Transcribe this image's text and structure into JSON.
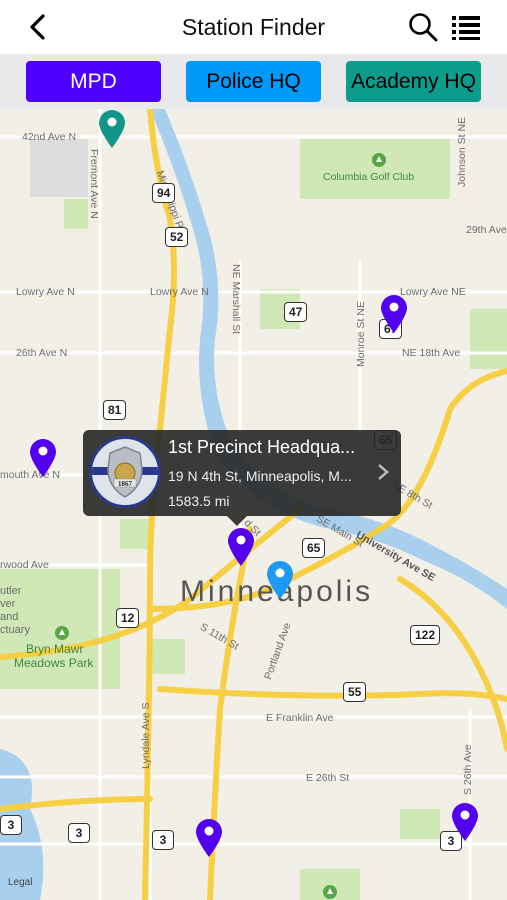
{
  "header": {
    "title": "Station Finder"
  },
  "filters": [
    {
      "label": "MPD",
      "color": "#4d00ff"
    },
    {
      "label": "Police HQ",
      "color": "#0099f8"
    },
    {
      "label": "Academy HQ",
      "color": "#0c9c8c"
    }
  ],
  "map": {
    "city": "Minneapolis",
    "legal": "Legal",
    "street_labels": [
      "42nd Ave N",
      "Fremont Ave N",
      "Mississippi River",
      "Columbia Golf Club",
      "Johnson St NE",
      "29th Ave",
      "Lowry Ave N",
      "Lowry Ave N",
      "NE Marshall St",
      "Lowry Ave NE",
      "26th Ave N",
      "NE 18th Ave",
      "Monroe St NE",
      "mouth Ave N",
      "SE 8th St",
      "SE Main St",
      "University Ave SE",
      "rwood Ave",
      "utler",
      "ver",
      "and",
      "ctuary",
      "Bryn Mawr",
      "Meadows Park",
      "S 11th St",
      "Portland Ave",
      "E Franklin Ave",
      "E 26th St",
      "Lyndale Ave S",
      "S 26th Ave",
      "d St"
    ],
    "shields": [
      "94",
      "52",
      "47",
      "81",
      "65",
      "65",
      "12",
      "122",
      "55",
      "3",
      "3",
      "3",
      "3",
      "67"
    ]
  },
  "callout": {
    "name": "1st Precinct Headqua...",
    "address": "19 N 4th St, Minneapolis, M...",
    "distance": "1583.5 mi",
    "badge_year": "1867"
  }
}
